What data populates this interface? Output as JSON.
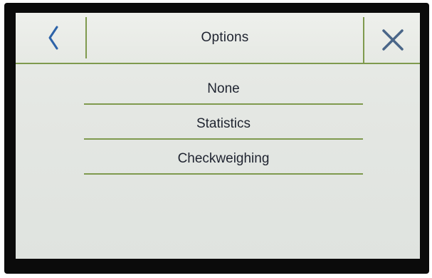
{
  "header": {
    "title": "Options",
    "back_icon": "chevron-left-icon",
    "close_icon": "close-icon"
  },
  "options": [
    {
      "label": "None"
    },
    {
      "label": "Statistics"
    },
    {
      "label": "Checkweighing"
    }
  ],
  "colors": {
    "accent_line": "#7f9a4e",
    "icon_blue": "#2d63a8",
    "text": "#1f2430",
    "screen_bg": "#e6e9e4",
    "bezel": "#0b0b0b"
  }
}
